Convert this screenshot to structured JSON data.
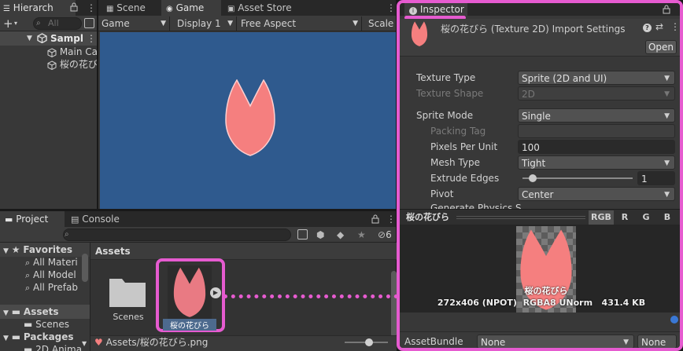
{
  "hierarchy": {
    "tab_label": "Hierarch",
    "search_placeholder": "All",
    "scene_name": "Sampl",
    "items": [
      "Main Ca",
      "桜の花び"
    ]
  },
  "scene_view": {
    "tabs": [
      "Scene",
      "Game",
      "Asset Store"
    ],
    "toolbar": {
      "display_mode": "Game",
      "display": "Display 1",
      "aspect": "Free Aspect",
      "scale_label": "Scale"
    },
    "background_color": "#2f5a8e",
    "sprite_color": "#f57f7f"
  },
  "project": {
    "tabs": [
      "Project",
      "Console"
    ],
    "search_value": "",
    "visible_count": "6",
    "tree": {
      "favorites_label": "Favorites",
      "favorites_items": [
        "All Materi",
        "All Model",
        "All Prefab"
      ],
      "assets_label": "Assets",
      "assets_items": [
        "Scenes"
      ],
      "packages_label": "Packages",
      "packages_items": [
        "2D Anima"
      ]
    },
    "breadcrumb": "Assets",
    "grid_items": [
      {
        "name": "Scenes",
        "icon": "folder-icon"
      },
      {
        "name": "桜の花びら",
        "icon": "sprite-thumbnail"
      }
    ],
    "status_path": "Assets/桜の花びら.png"
  },
  "inspector": {
    "tab_label": "Inspector",
    "title": "桜の花びら (Texture 2D) Import Settings",
    "open_button": "Open",
    "properties": {
      "texture_type_label": "Texture Type",
      "texture_type_value": "Sprite (2D and UI)",
      "texture_shape_label": "Texture Shape",
      "texture_shape_value": "2D",
      "sprite_mode_label": "Sprite Mode",
      "sprite_mode_value": "Single",
      "packing_tag_label": "Packing Tag",
      "packing_tag_value": "",
      "ppu_label": "Pixels Per Unit",
      "ppu_value": "100",
      "mesh_type_label": "Mesh Type",
      "mesh_type_value": "Tight",
      "extrude_label": "Extrude Edges",
      "extrude_value": "1",
      "extrude_fraction": 0.0625,
      "pivot_label": "Pivot",
      "pivot_value": "Center",
      "physics_label": "Generate Physics S"
    },
    "preview": {
      "name": "桜の花びら",
      "channels": [
        "RGB",
        "R",
        "G",
        "B"
      ],
      "caption": "桜の花びら",
      "info": "272x406 (NPOT)  RGBA8 UNorm   431.4 KB"
    },
    "asset_bundle": {
      "label": "AssetBundle",
      "name_value": "None",
      "variant_value": "None"
    }
  },
  "colors": {
    "highlight": "#e65bd0",
    "sprite_pink": "#f57f7f",
    "game_bg": "#2f5a8e"
  }
}
